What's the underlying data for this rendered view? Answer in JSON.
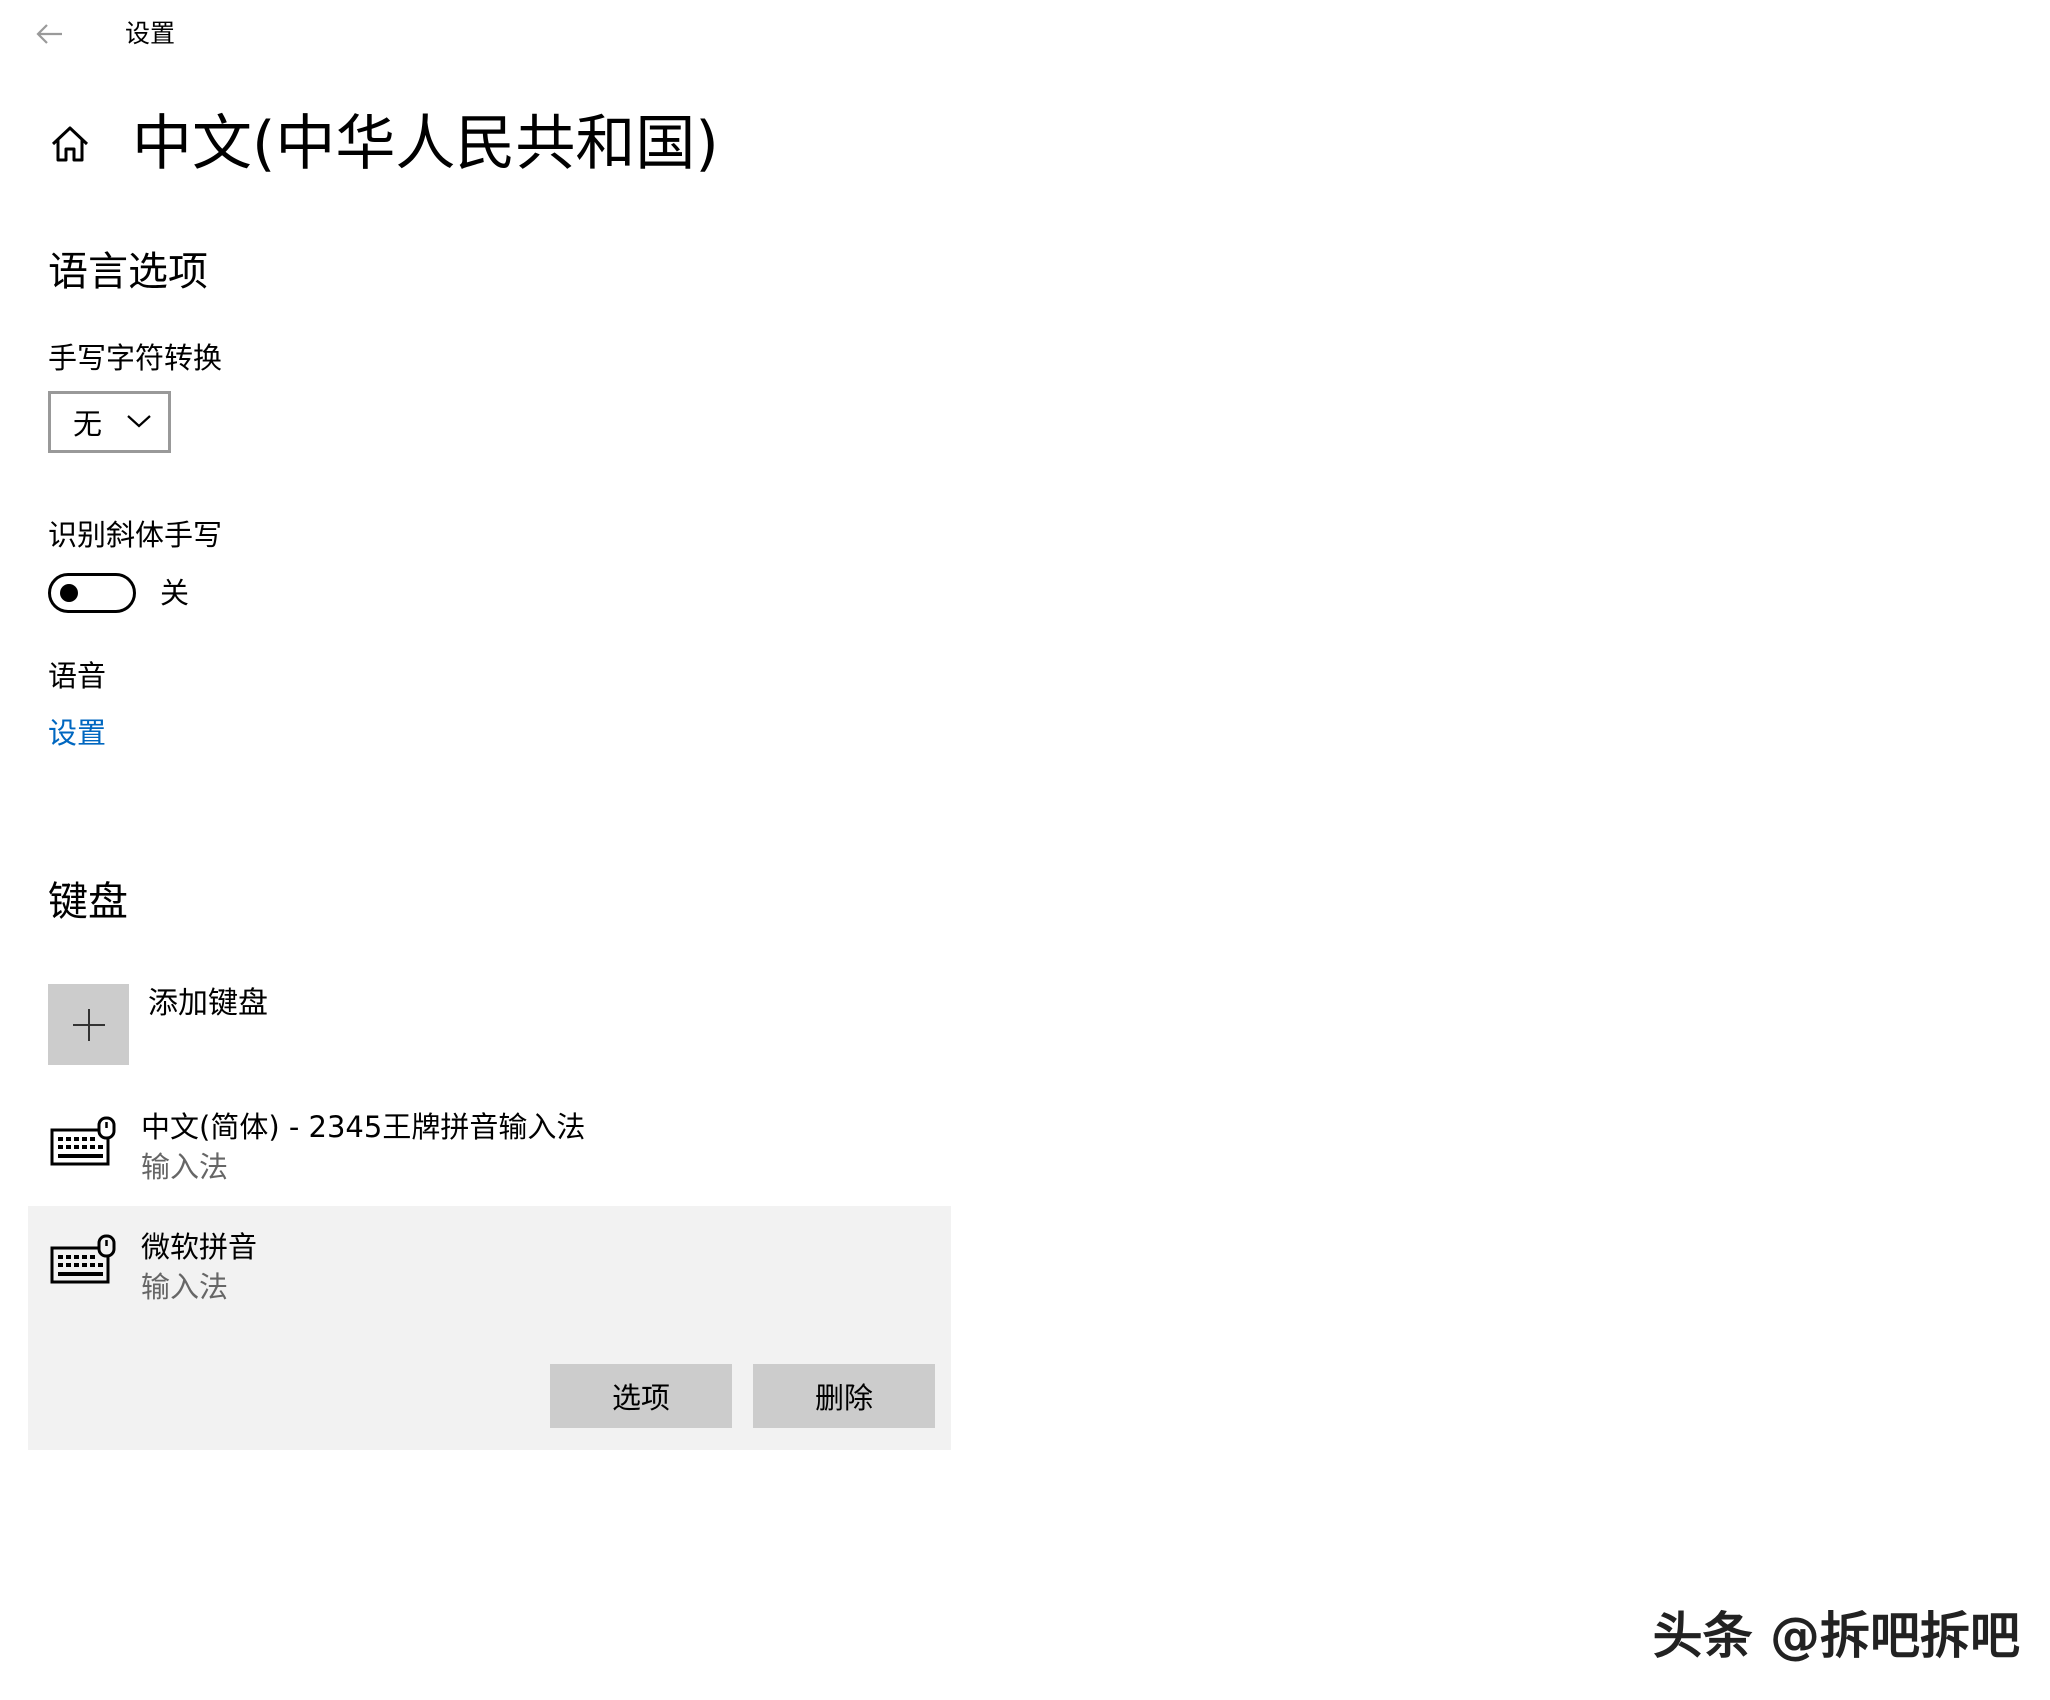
{
  "titlebar": {
    "back_icon": "back-arrow-icon",
    "app_title": "设置"
  },
  "header": {
    "home_icon": "home-icon",
    "page_title": "中文(中华人民共和国)"
  },
  "language_options": {
    "heading": "语言选项",
    "handwriting_conversion": {
      "label": "手写字符转换",
      "selected_value": "无"
    },
    "italic_handwriting": {
      "label": "识别斜体手写",
      "toggle_on": false,
      "state_text": "关"
    },
    "speech": {
      "label": "语音",
      "link_text": "设置"
    }
  },
  "keyboard": {
    "heading": "键盘",
    "add_label": "添加键盘",
    "items": [
      {
        "name": "中文(简体) - 2345王牌拼音输入法",
        "subtitle": "输入法",
        "selected": false
      },
      {
        "name": "微软拼音",
        "subtitle": "输入法",
        "selected": true
      }
    ],
    "options_button": "选项",
    "remove_button": "删除"
  },
  "watermark": "头条 @拆吧拆吧",
  "colors": {
    "link": "#0067c0",
    "selected_row_bg": "#f2f2f2",
    "button_bg": "#cccccc",
    "subtitle_text": "#666666"
  }
}
